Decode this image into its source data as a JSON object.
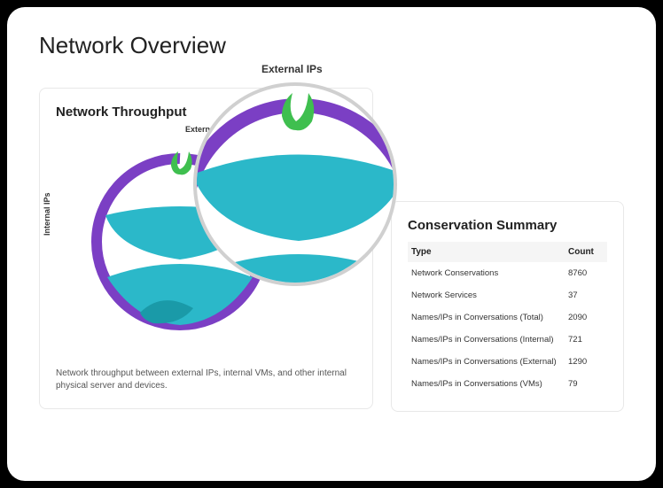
{
  "page": {
    "title": "Network Overview"
  },
  "throughput": {
    "title": "Network Throughput",
    "label_external_small": "External",
    "label_internal": "Internal IPs",
    "label_external_big": "External IPs",
    "caption": "Network throughput between external IPs, internal VMs, and other internal physical server and devices."
  },
  "summary": {
    "title": "Conservation Summary",
    "columns": {
      "type": "Type",
      "count": "Count"
    },
    "rows": [
      {
        "type": "Network Conservations",
        "count": "8760"
      },
      {
        "type": "Network Services",
        "count": "37"
      },
      {
        "type": "Names/IPs in Conversations (Total)",
        "count": "2090"
      },
      {
        "type": "Names/IPs in Conversations (Internal)",
        "count": "721"
      },
      {
        "type": "Names/IPs in Conversations (External)",
        "count": "1290"
      },
      {
        "type": "Names/IPs in Conversations (VMs)",
        "count": "79"
      }
    ]
  },
  "colors": {
    "purple": "#7b3fc4",
    "teal": "#2bb8c9",
    "green": "#3fbf4f",
    "darkteal": "#1a9aa8"
  }
}
